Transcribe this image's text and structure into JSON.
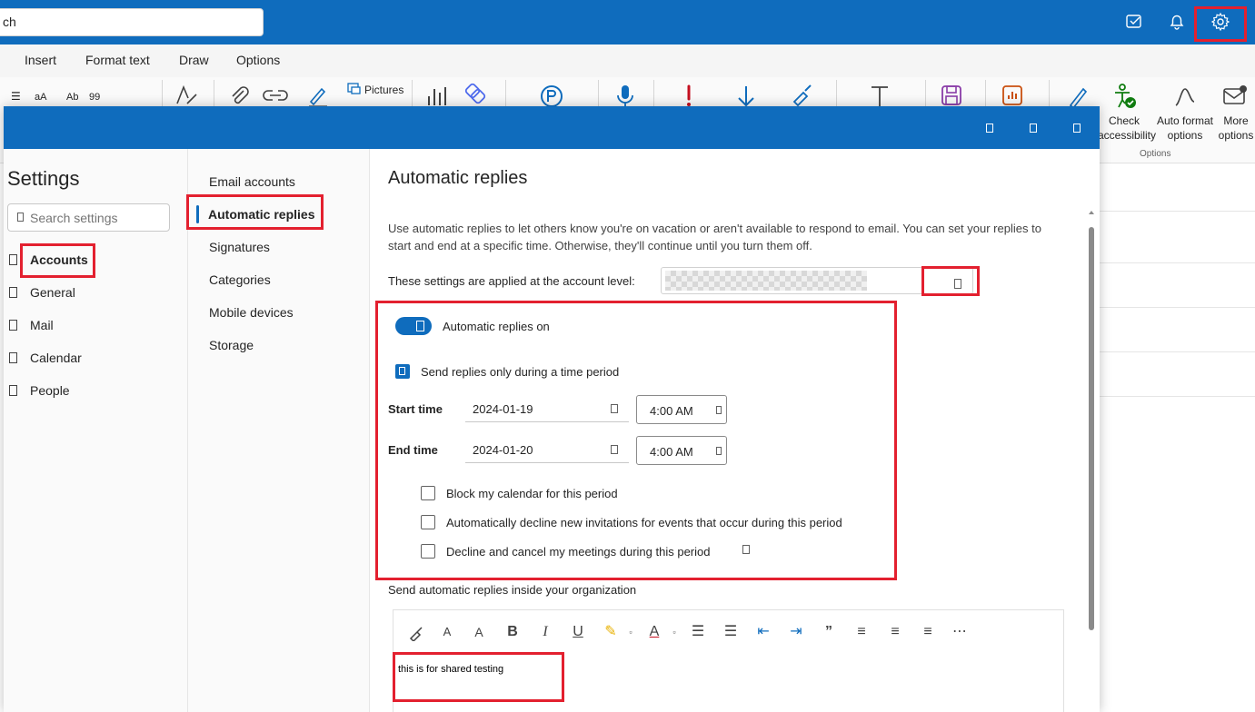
{
  "topbar": {
    "search_value": "ch",
    "icons": [
      "tasks-icon",
      "bell-icon",
      "gear-icon"
    ]
  },
  "menu": {
    "tabs": [
      "Insert",
      "Format text",
      "Draw",
      "Options"
    ]
  },
  "ribbon": {
    "pictures_label": "Pictures",
    "format_glyphs": [
      "aA",
      "Ab",
      "99"
    ],
    "check_accessibility": [
      "Check",
      "accessibility"
    ],
    "auto_format": [
      "Auto format",
      "options"
    ],
    "more_options": [
      "More",
      "options"
    ],
    "group_label": "Options"
  },
  "settings": {
    "title": "Settings",
    "search_placeholder": "Search settings",
    "categories": [
      "Accounts",
      "General",
      "Mail",
      "Calendar",
      "People"
    ],
    "subcategories": [
      "Email accounts",
      "Automatic replies",
      "Signatures",
      "Categories",
      "Mobile devices",
      "Storage"
    ]
  },
  "auto_replies": {
    "title": "Automatic replies",
    "description": "Use automatic replies to let others know you're on vacation or aren't available to respond to email. You can set your replies to start and end at a specific time. Otherwise, they'll continue until you turn them off.",
    "account_label": "These settings are applied at the account level:",
    "toggle_label": "Automatic replies on",
    "toggle_on": true,
    "period_label": "Send replies only during a time period",
    "period_checked": true,
    "start_label": "Start time",
    "start_date": "2024-01-19",
    "start_time": "4:00 AM",
    "end_label": "End time",
    "end_date": "2024-01-20",
    "end_time": "4:00 AM",
    "options": [
      "Block my calendar for this period",
      "Automatically decline new invitations for events that occur during this period",
      "Decline and cancel my meetings during this period"
    ],
    "inside_label": "Send automatic replies inside your organization",
    "message": "this is for shared testing"
  },
  "colors": {
    "brand": "#0f6cbd",
    "highlight": "#e3202f"
  }
}
